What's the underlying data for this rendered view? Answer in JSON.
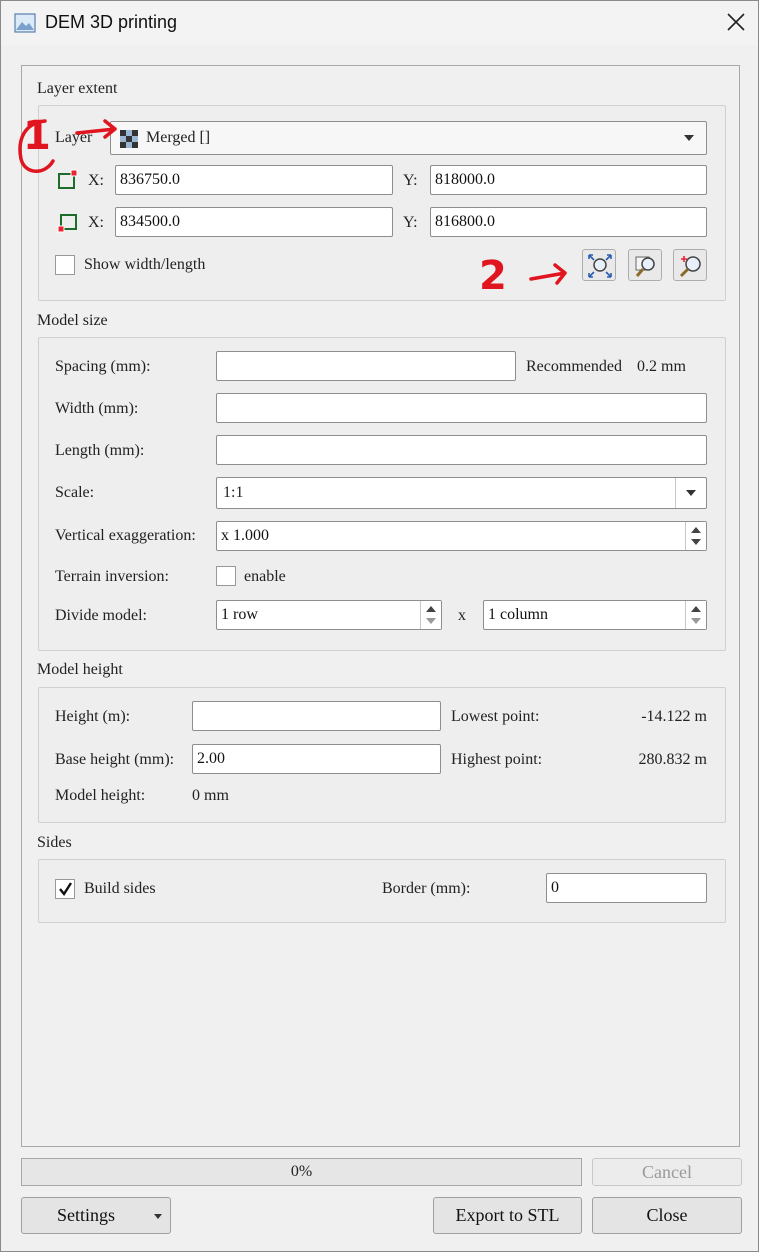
{
  "window": {
    "title": "DEM 3D printing"
  },
  "layer_extent": {
    "group_title": "Layer extent",
    "layer_label": "Layer",
    "layer_value": "Merged []",
    "x_label": "X:",
    "y_label": "Y:",
    "top_right": {
      "x": "836750.0",
      "y": "818000.0"
    },
    "bottom_left": {
      "x": "834500.0",
      "y": "816800.0"
    },
    "show_width_length_label": "Show width/length",
    "show_width_length_checked": false,
    "icons": [
      "zoom-full-extent-icon",
      "zoom-layer-icon",
      "zoom-select-icon"
    ]
  },
  "annotations": {
    "mark1": "1",
    "mark2": "2",
    "color": "#e0151f"
  },
  "model_size": {
    "group_title": "Model size",
    "spacing_label": "Spacing (mm):",
    "spacing_value": "",
    "recommended_label": "Recommended",
    "recommended_value": "0.2 mm",
    "width_label": "Width (mm):",
    "width_value": "",
    "length_label": "Length (mm):",
    "length_value": "",
    "scale_label": "Scale:",
    "scale_value": "1:1",
    "vertical_label": "Vertical exaggeration:",
    "vertical_value": "x 1.000",
    "inversion_label": "Terrain inversion:",
    "inversion_enable_label": "enable",
    "inversion_checked": false,
    "divide_label": "Divide model:",
    "divide_rows": "1 row",
    "divide_x": "x",
    "divide_cols": "1 column"
  },
  "model_height": {
    "group_title": "Model height",
    "height_label": "Height (m):",
    "height_value": "",
    "base_label": "Base height (mm):",
    "base_value": "2.00",
    "lowest_label": "Lowest point:",
    "lowest_value": "-14.122 m",
    "highest_label": "Highest point:",
    "highest_value": "280.832 m",
    "model_height_label": "Model height:",
    "model_height_value": "0 mm"
  },
  "sides": {
    "group_title": "Sides",
    "build_sides_label": "Build sides",
    "build_sides_checked": true,
    "border_label": "Border (mm):",
    "border_value": "0"
  },
  "footer": {
    "progress_text": "0%",
    "progress_value": 0,
    "cancel_label": "Cancel",
    "settings_label": "Settings",
    "export_label": "Export to STL",
    "close_label": "Close"
  }
}
